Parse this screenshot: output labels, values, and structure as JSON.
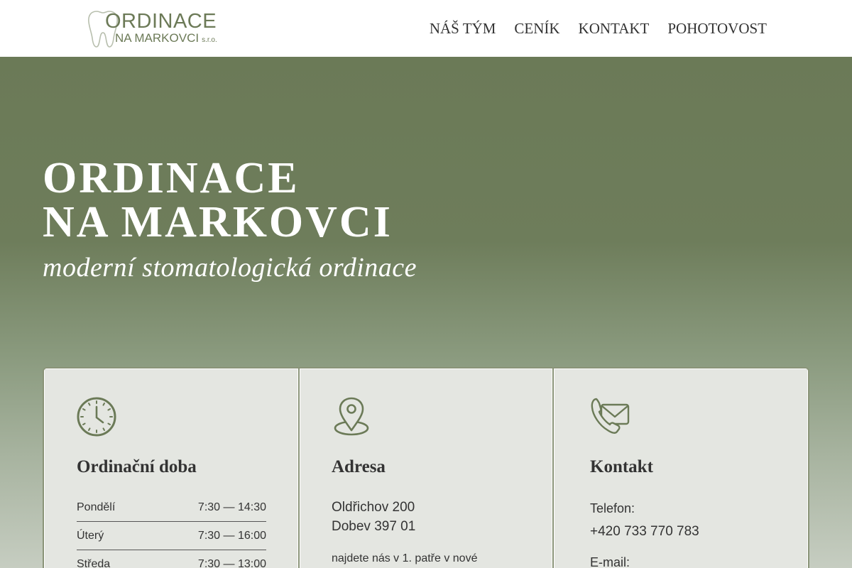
{
  "logo": {
    "line1": "ORDINACE",
    "line2": "NA MARKOVCI",
    "suffix": "s.r.o.",
    "icon": "tooth-icon",
    "color": "#6c7a57"
  },
  "nav": {
    "items": [
      {
        "label": "NÁŠ TÝM"
      },
      {
        "label": "CENÍK"
      },
      {
        "label": "KONTAKT"
      },
      {
        "label": "POHOTOVOST"
      }
    ]
  },
  "hero": {
    "title_line1": "ORDINACE",
    "title_line2": "NA MARKOVCI",
    "subtitle": "moderní stomatologická ordinace"
  },
  "cards": {
    "hours": {
      "icon": "clock-icon",
      "title": "Ordinační doba",
      "rows": [
        {
          "day": "Pondělí",
          "time": "7:30 — 14:30"
        },
        {
          "day": "Úterý",
          "time": "7:30 — 16:00"
        },
        {
          "day": "Středa",
          "time": "7:30 — 13:00"
        }
      ]
    },
    "address": {
      "icon": "map-pin-icon",
      "title": "Adresa",
      "line1": "Oldřichov 200",
      "line2": "Dobev 397 01",
      "note": "najdete nás v 1. patře v nové"
    },
    "contact": {
      "icon": "phone-mail-icon",
      "title": "Kontakt",
      "phone_label": "Telefon:",
      "phone": "+420 733 770 783",
      "email_label": "E-mail:"
    }
  },
  "colors": {
    "accent": "#6b7a57",
    "card_bg": "#e4e6e1",
    "text": "#333333"
  }
}
